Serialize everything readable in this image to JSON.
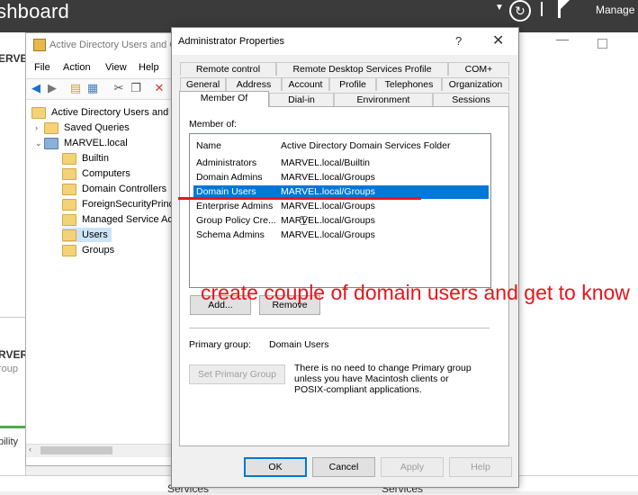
{
  "server_manager": {
    "title": "shboard",
    "manage_label": "Manage",
    "left_labels": [
      "ERVE",
      "RVER",
      "roup",
      "bility"
    ],
    "services_labels": [
      "Services",
      "Services"
    ]
  },
  "aduc": {
    "title": "Active Directory Users and C",
    "menu": [
      "File",
      "Action",
      "View",
      "Help"
    ],
    "tree": [
      {
        "label": "Active Directory Users and C",
        "indent": 0
      },
      {
        "label": "Saved Queries",
        "indent": 1
      },
      {
        "label": "MARVEL.local",
        "indent": 1
      },
      {
        "label": "Builtin",
        "indent": 2
      },
      {
        "label": "Computers",
        "indent": 2
      },
      {
        "label": "Domain Controllers",
        "indent": 2
      },
      {
        "label": "ForeignSecurityPrinci",
        "indent": 2
      },
      {
        "label": "Managed Service Acc",
        "indent": 2
      },
      {
        "label": "Users",
        "indent": 2,
        "selected": true
      },
      {
        "label": "Groups",
        "indent": 2
      }
    ]
  },
  "dialog": {
    "title": "Administrator Properties",
    "help_glyph": "?",
    "close_glyph": "✕",
    "tabs_row1": [
      "Remote control",
      "Remote Desktop Services Profile",
      "COM+"
    ],
    "tabs_row2": [
      "General",
      "Address",
      "Account",
      "Profile",
      "Telephones",
      "Organization"
    ],
    "tabs_row3": [
      "Member Of",
      "Dial-in",
      "Environment",
      "Sessions"
    ],
    "active_tab": "Member Of",
    "member_of_label": "Member of:",
    "columns": [
      "Name",
      "Active Directory Domain Services Folder"
    ],
    "rows": [
      {
        "name": "Administrators",
        "folder": "MARVEL.local/Builtin"
      },
      {
        "name": "Domain Admins",
        "folder": "MARVEL.local/Groups"
      },
      {
        "name": "Domain Users",
        "folder": "MARVEL.local/Groups",
        "selected": true
      },
      {
        "name": "Enterprise Admins",
        "folder": "MARVEL.local/Groups"
      },
      {
        "name": "Group Policy Cre...",
        "folder": "MARVEL.local/Groups"
      },
      {
        "name": "Schema Admins",
        "folder": "MARVEL.local/Groups"
      }
    ],
    "add_label": "Add...",
    "remove_label": "Remove",
    "primary_group_label": "Primary group:",
    "primary_group_value": "Domain Users",
    "set_primary_label": "Set Primary Group",
    "note": "There is no need to change Primary group unless you have Macintosh clients or POSIX-compliant applications.",
    "ok_label": "OK",
    "cancel_label": "Cancel",
    "apply_label": "Apply",
    "help_label": "Help"
  },
  "annotation": {
    "text": "create couple of domain users and get to know",
    "color": "#e8141b"
  }
}
